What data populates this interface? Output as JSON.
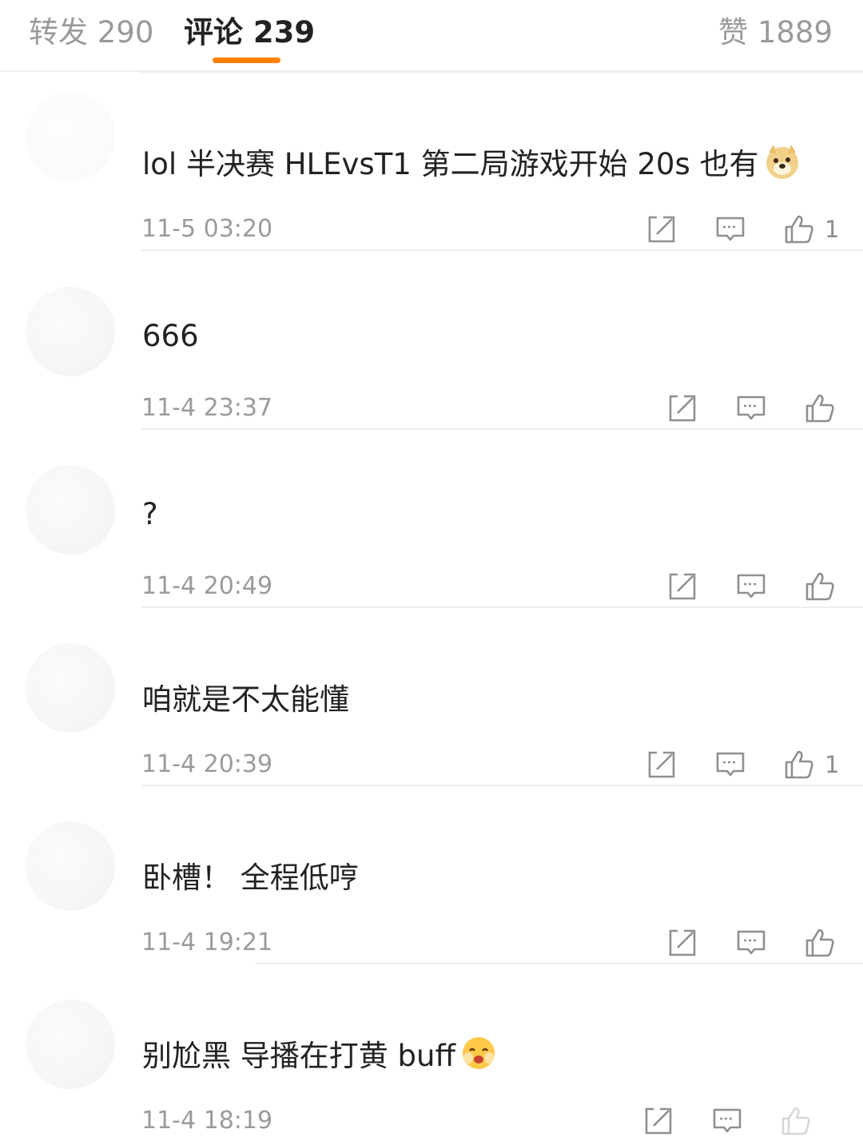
{
  "tabs": {
    "repost": "转发 290",
    "comments": "评论 239",
    "likes": "赞 1889"
  },
  "icons": {
    "share": "share-icon",
    "reply": "comment-bubble-icon",
    "like": "thumbs-up-icon"
  },
  "colors": {
    "accent": "#ff8200",
    "icon": "#8f8f8f",
    "time": "#9b9b9b"
  },
  "comments": [
    {
      "text": "lol 半决赛 HLEvsT1 第二局游戏开始 20s 也有",
      "emoji": "doge-emoji",
      "time": "11-5 03:20",
      "likes": "1"
    },
    {
      "text": "666",
      "time": "11-4 23:37",
      "likes": ""
    },
    {
      "text": "?",
      "time": "11-4 20:49",
      "likes": ""
    },
    {
      "text": "咱就是不太能懂",
      "time": "11-4 20:39",
      "likes": "1"
    },
    {
      "text": "卧槽！ 全程低哼",
      "time": "11-4 19:21",
      "likes": ""
    },
    {
      "text": "别尬黑 导播在打黄 buff",
      "emoji": "blush-emoji",
      "time": "11-4 18:19",
      "likes": ""
    }
  ]
}
